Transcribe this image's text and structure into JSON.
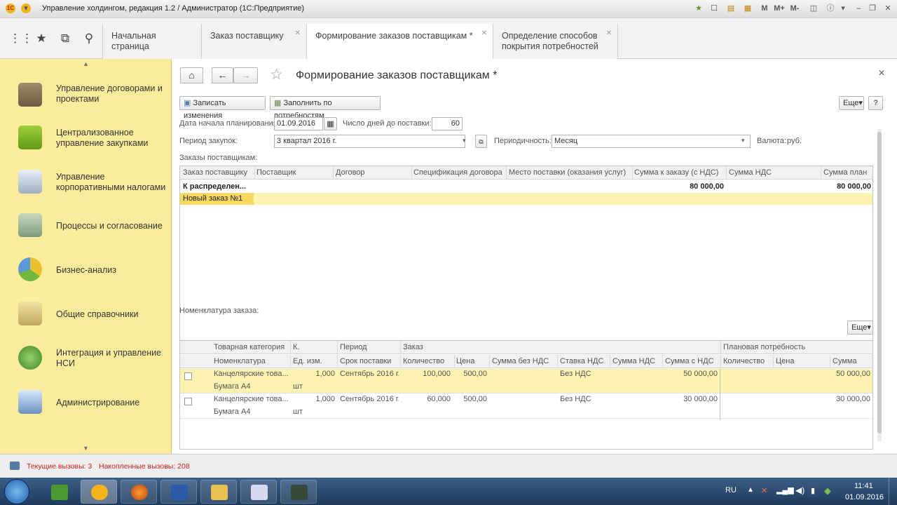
{
  "window": {
    "title": "Управление холдингом, редакция 1.2 / Администратор  (1С:Предприятие)"
  },
  "window_controls": [
    "M",
    "M+",
    "M-"
  ],
  "tabs": [
    {
      "label": "Начальная страница"
    },
    {
      "label": "Заказ поставщику"
    },
    {
      "label": "Формирование заказов поставщикам *"
    },
    {
      "label": "Определение способов покрытия потребностей"
    }
  ],
  "sidebar": {
    "items": [
      {
        "label": "Управление договорами и проектами"
      },
      {
        "label": "Централизованное управление закупками"
      },
      {
        "label": "Управление корпоративными налогами"
      },
      {
        "label": "Процессы и согласование"
      },
      {
        "label": "Бизнес-анализ"
      },
      {
        "label": "Общие справочники"
      },
      {
        "label": "Интеграция и управление НСИ"
      },
      {
        "label": "Администрирование"
      }
    ]
  },
  "form": {
    "title": "Формирование заказов поставщикам *",
    "save_label": "Записать изменения",
    "fill_label": "Заполнить по потребностям",
    "more_label": "Еще",
    "help_label": "?",
    "start_date_label": "Дата начала планирования:",
    "start_date": "01.09.2016",
    "days_label": "Число дней до поставки:",
    "days": "60",
    "period_label": "Период закупок:",
    "period": "3 квартал 2016 г.",
    "periodicity_label": "Периодичность:",
    "periodicity": "Месяц",
    "currency_label": "Валюта:",
    "currency": "руб.",
    "orders_label": "Заказы поставщикам:",
    "nomenclature_label": "Номенклатура заказа:"
  },
  "orders_table": {
    "columns": [
      "Заказ поставщику",
      "Поставщик",
      "Договор",
      "Спецификация договора",
      "Место поставки (оказания услуг)",
      "Сумма к заказу (с НДС)",
      "Сумма НДС",
      "Сумма план"
    ],
    "rows": [
      {
        "order": "К распределен...",
        "sum": "80 000,00",
        "plan": "80 000,00"
      },
      {
        "order": "Новый заказ №1",
        "sum": "",
        "plan": ""
      }
    ]
  },
  "nom_table": {
    "groups": [
      "Заказ",
      "Плановая потребность"
    ],
    "header1": [
      "Товарная категория",
      "К.",
      "Период"
    ],
    "header2": [
      "Номенклатура",
      "Ед. изм.",
      "Срок поставки",
      "Количество",
      "Цена",
      "Сумма без НДС",
      "Ставка НДС",
      "Сумма НДС",
      "Сумма с НДС",
      "Количество",
      "Цена",
      "Сумма"
    ],
    "rows": [
      {
        "category": "Канцелярские това...",
        "k": "1,000",
        "period": "Сентябрь 2016 г.",
        "qty": "100,000",
        "price": "500,00",
        "vat_rate": "Без НДС",
        "sum_vat": "50 000,00",
        "plan_sum": "50 000,00",
        "nomenclature": "Бумага А4",
        "unit": "шт"
      },
      {
        "category": "Канцелярские това...",
        "k": "1,000",
        "period": "Сентябрь 2016 г.",
        "qty": "60,000",
        "price": "500,00",
        "vat_rate": "Без НДС",
        "sum_vat": "30 000,00",
        "plan_sum": "30 000,00",
        "nomenclature": "Бумага А4",
        "unit": "шт"
      }
    ]
  },
  "status": {
    "current": "Текущие вызовы: 3",
    "accumulated": "Накопленные вызовы: 208"
  },
  "taskbar": {
    "lang": "RU",
    "time": "11:41",
    "date": "01.09.2016"
  },
  "colors": {
    "sidebar": "#fbec9c",
    "selection": "#fcf3b0",
    "status_text": "#d02020",
    "taskbar": "#1e3a5c"
  }
}
